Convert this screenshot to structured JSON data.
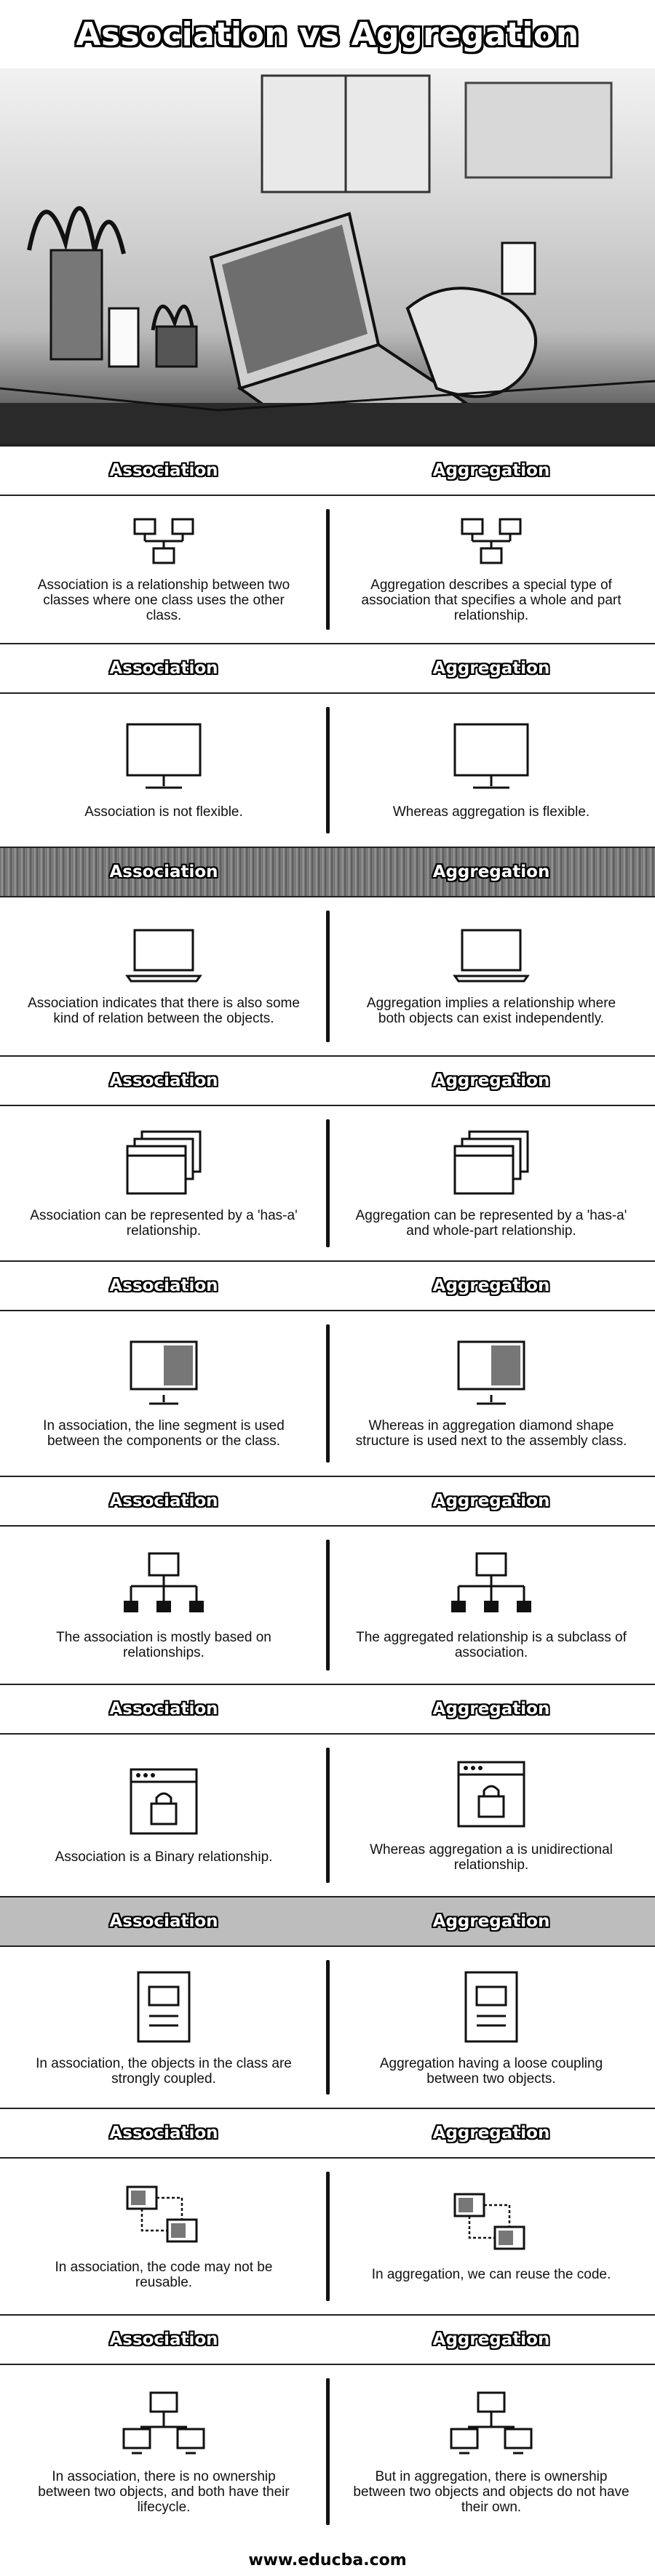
{
  "title": "Association vs Aggregation",
  "footer": "www.educba.com",
  "rows": [
    {
      "left_header": "Association",
      "right_header": "Aggregation",
      "band": "plain",
      "icon": "network-icon",
      "left": "Association is a relationship between two classes where one class uses the other class.",
      "right": "Aggregation describes a special type of association that specifies a whole and part relationship."
    },
    {
      "left_header": "Association",
      "right_header": "Aggregation",
      "band": "plain",
      "icon": "monitor-icon",
      "left": "Association is not flexible.",
      "right": "Whereas aggregation is flexible."
    },
    {
      "left_header": "Association",
      "right_header": "Aggregation",
      "band": "dark",
      "icon": "laptop-icon",
      "left": "Association indicates that there is also some kind of relation between the objects.",
      "right": "Aggregation implies a relationship where both objects can exist independently."
    },
    {
      "left_header": "Association",
      "right_header": "Aggregation",
      "band": "plain",
      "icon": "windows-stack-icon",
      "left": "Association can be represented by a 'has-a' relationship.",
      "right": "Aggregation can be represented by a 'has-a' and whole-part relationship."
    },
    {
      "left_header": "Association",
      "right_header": "Aggregation",
      "band": "plain",
      "icon": "split-monitor-icon",
      "left": "In association, the line segment is used between the components or the class.",
      "right": "Whereas in aggregation diamond shape structure is used next to the assembly class."
    },
    {
      "left_header": "Association",
      "right_header": "Aggregation",
      "band": "plain",
      "icon": "hierarchy-icon",
      "left": "The association is mostly based on relationships.",
      "right": "The aggregated relationship is a subclass of association."
    },
    {
      "left_header": "Association",
      "right_header": "Aggregation",
      "band": "plain",
      "icon": "lock-window-icon",
      "left": "Association is a Binary relationship.",
      "right": "Whereas aggregation a is unidirectional relationship."
    },
    {
      "left_header": "Association",
      "right_header": "Aggregation",
      "band": "grey",
      "icon": "document-icon",
      "left": "In association, the objects in the class are strongly coupled.",
      "right": "Aggregation having a loose coupling between two objects."
    },
    {
      "left_header": "Association",
      "right_header": "Aggregation",
      "band": "plain",
      "icon": "linked-monitors-icon",
      "left": "In association, the code may not be reusable.",
      "right": "In aggregation, we can reuse the code."
    },
    {
      "left_header": "Association",
      "right_header": "Aggregation",
      "band": "plain",
      "icon": "three-monitors-icon",
      "left": "In association, there is no ownership between two objects, and both have their lifecycle.",
      "right": "But in aggregation, there is ownership between two objects and objects do not have their own."
    }
  ]
}
